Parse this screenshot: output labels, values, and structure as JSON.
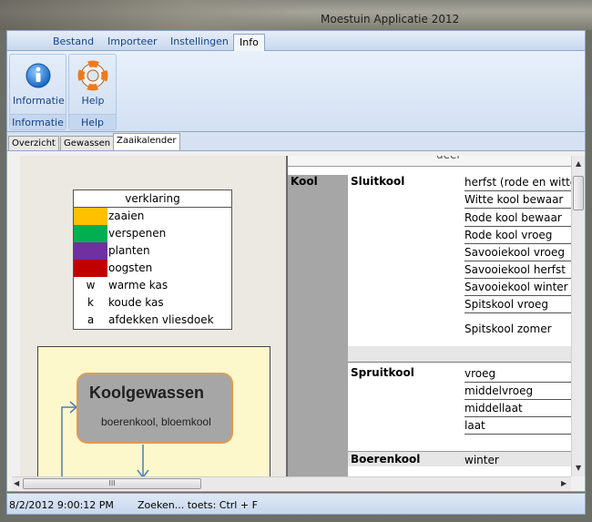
{
  "window": {
    "title": "Moestuin Applicatie 2012"
  },
  "ribbon": {
    "tabs": [
      "Bestand",
      "Importeer",
      "Instellingen",
      "Info"
    ],
    "active_tab": "Info",
    "groups": [
      {
        "footer": "Informatie",
        "button": "Informatie",
        "icon": "info-icon"
      },
      {
        "footer": "Help",
        "button": "Help",
        "icon": "lifebuoy-icon"
      }
    ]
  },
  "main_tabs": [
    "Overzicht",
    "Gewassen",
    "Zaaikalender"
  ],
  "active_main_tab": "Zaaikalender",
  "legend": {
    "title": "verklaring",
    "rows": [
      {
        "swatch": "#ffc000",
        "symbol": "",
        "label": "zaaien"
      },
      {
        "swatch": "#00b050",
        "symbol": "",
        "label": "verspenen"
      },
      {
        "swatch": "#7030a0",
        "symbol": "",
        "label": "planten"
      },
      {
        "swatch": "#c00000",
        "symbol": "",
        "label": "oogsten"
      },
      {
        "swatch": "",
        "symbol": "w",
        "label": "warme kas"
      },
      {
        "swatch": "",
        "symbol": "k",
        "label": "koude kas"
      },
      {
        "swatch": "",
        "symbol": "a",
        "label": "afdekken vliesdoek"
      }
    ]
  },
  "flow": {
    "node_title": "Koolgewassen",
    "node_subtitle": "boerenkool, bloemkool"
  },
  "grid": {
    "header_partial": "deel",
    "category": "Kool",
    "groups": [
      {
        "name": "Sluitkool",
        "varieties": [
          "herfst (rode en witte)",
          "Witte kool bewaar",
          "Rode kool bewaar",
          "Rode kool vroeg",
          "Savooiekool vroeg",
          "Savooiekool herfst",
          "Savooiekool winter",
          "Spitskool vroeg",
          "Spitskool zomer"
        ]
      },
      {
        "name": "Spruitkool",
        "varieties": [
          "vroeg",
          "middelvroeg",
          "middellaat",
          "laat"
        ]
      },
      {
        "name": "Boerenkool",
        "varieties": [
          "winter"
        ]
      }
    ]
  },
  "scrollbar": {
    "h_thumb_grip": "III"
  },
  "status": {
    "datetime": "8/2/2012 9:00:12 PM",
    "hint": "Zoeken... toets: Ctrl + F"
  },
  "colors": {
    "ribbon_text": "#15428b",
    "category_gray": "#a6a6a6",
    "node_border": "#e49a4c",
    "flow_bg": "#fdf8cc"
  }
}
